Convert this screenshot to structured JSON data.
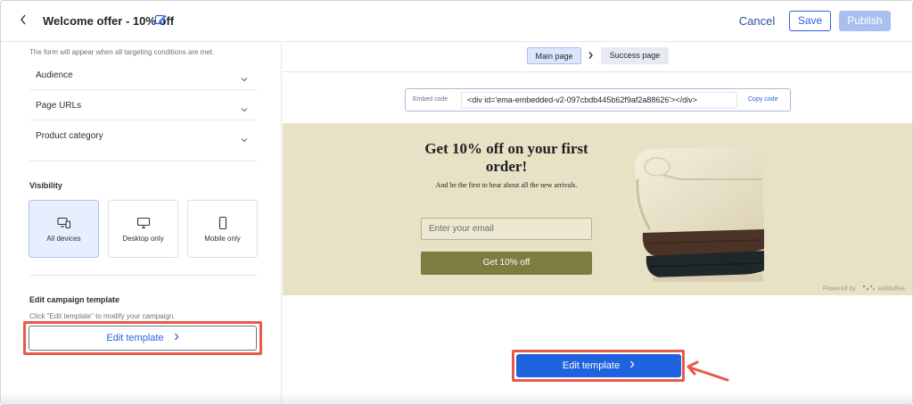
{
  "header": {
    "back_icon": "chevron-left-icon",
    "title": "Welcome offer - 10% off",
    "edit_icon": "pencil-icon",
    "cancel_label": "Cancel",
    "save_label": "Save",
    "publish_label": "Publish"
  },
  "sidebar": {
    "targeting_hint": "The form will appear when all targeting conditions are met.",
    "conditions": [
      {
        "label": "Audience"
      },
      {
        "label": "Page URLs"
      },
      {
        "label": "Product category"
      }
    ],
    "visibility": {
      "title": "Visibility",
      "options": [
        {
          "label": "All devices",
          "icon": "devices-icon",
          "selected": true
        },
        {
          "label": "Desktop only",
          "icon": "desktop-icon",
          "selected": false
        },
        {
          "label": "Mobile only",
          "icon": "mobile-icon",
          "selected": false
        }
      ]
    },
    "template": {
      "title": "Edit campaign template",
      "hint": "Click \"Edit template\" to modify your campaign.",
      "button_label": "Edit template"
    }
  },
  "main": {
    "tabs": [
      {
        "label": "Main page",
        "active": true
      },
      {
        "label": "Success page",
        "active": false
      }
    ],
    "embed": {
      "label": "Embed code",
      "code": "<div id='ema-embedded-v2-097cbdb445b62f9af2a88626'></div>",
      "copy_label": "Copy code"
    },
    "preview": {
      "headline": "Get 10% off on your first order!",
      "subtext": "And be the first to hear about all the new arrivals.",
      "email_placeholder": "Enter your email",
      "cta_label": "Get 10% off",
      "powered_by": "Powered by",
      "brand": "webtoffee",
      "image": "folded-sweaters-image",
      "background_color": "#e7e2c6",
      "cta_color": "#7e7c41"
    },
    "edit_button_label": "Edit template"
  },
  "colors": {
    "accent": "#1f63de",
    "highlight": "#e8594a"
  }
}
